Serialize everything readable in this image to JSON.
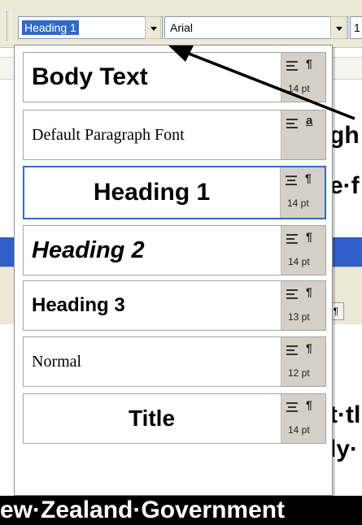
{
  "toolbar": {
    "style_value": "Heading 1",
    "font_value": "Arial",
    "size_value": "1"
  },
  "document": {
    "frag_gh": "gh",
    "frag_ef": "e·f",
    "frag_tt": "t·tl",
    "frag_ly": "ly·",
    "pilcrow": "¶",
    "banner": "ew·Zealand·Government"
  },
  "styles_list": [
    {
      "name": "Body Text",
      "symbol": "¶",
      "size": "14 pt"
    },
    {
      "name": "Default Paragraph Font",
      "symbol": "a",
      "size": ""
    },
    {
      "name": "Heading 1",
      "symbol": "¶",
      "size": "14 pt",
      "selected": true
    },
    {
      "name": "Heading 2",
      "symbol": "¶",
      "size": "14 pt"
    },
    {
      "name": "Heading 3",
      "symbol": "¶",
      "size": "13 pt"
    },
    {
      "name": "Normal",
      "symbol": "¶",
      "size": "12 pt"
    },
    {
      "name": "Title",
      "symbol": "¶",
      "size": "14 pt"
    }
  ],
  "icons": {
    "dropdown": "chevron-down-icon",
    "align_left": "align-left-icon",
    "align_center": "align-center-icon",
    "paragraph": "pilcrow-icon",
    "character": "character-style-icon",
    "annotation": "arrow-pointer-icon"
  },
  "colors": {
    "selection": "#316ac5",
    "toolbar": "#ece9d8",
    "meta_panel": "#d4d0c8",
    "annotation": "#000000"
  }
}
